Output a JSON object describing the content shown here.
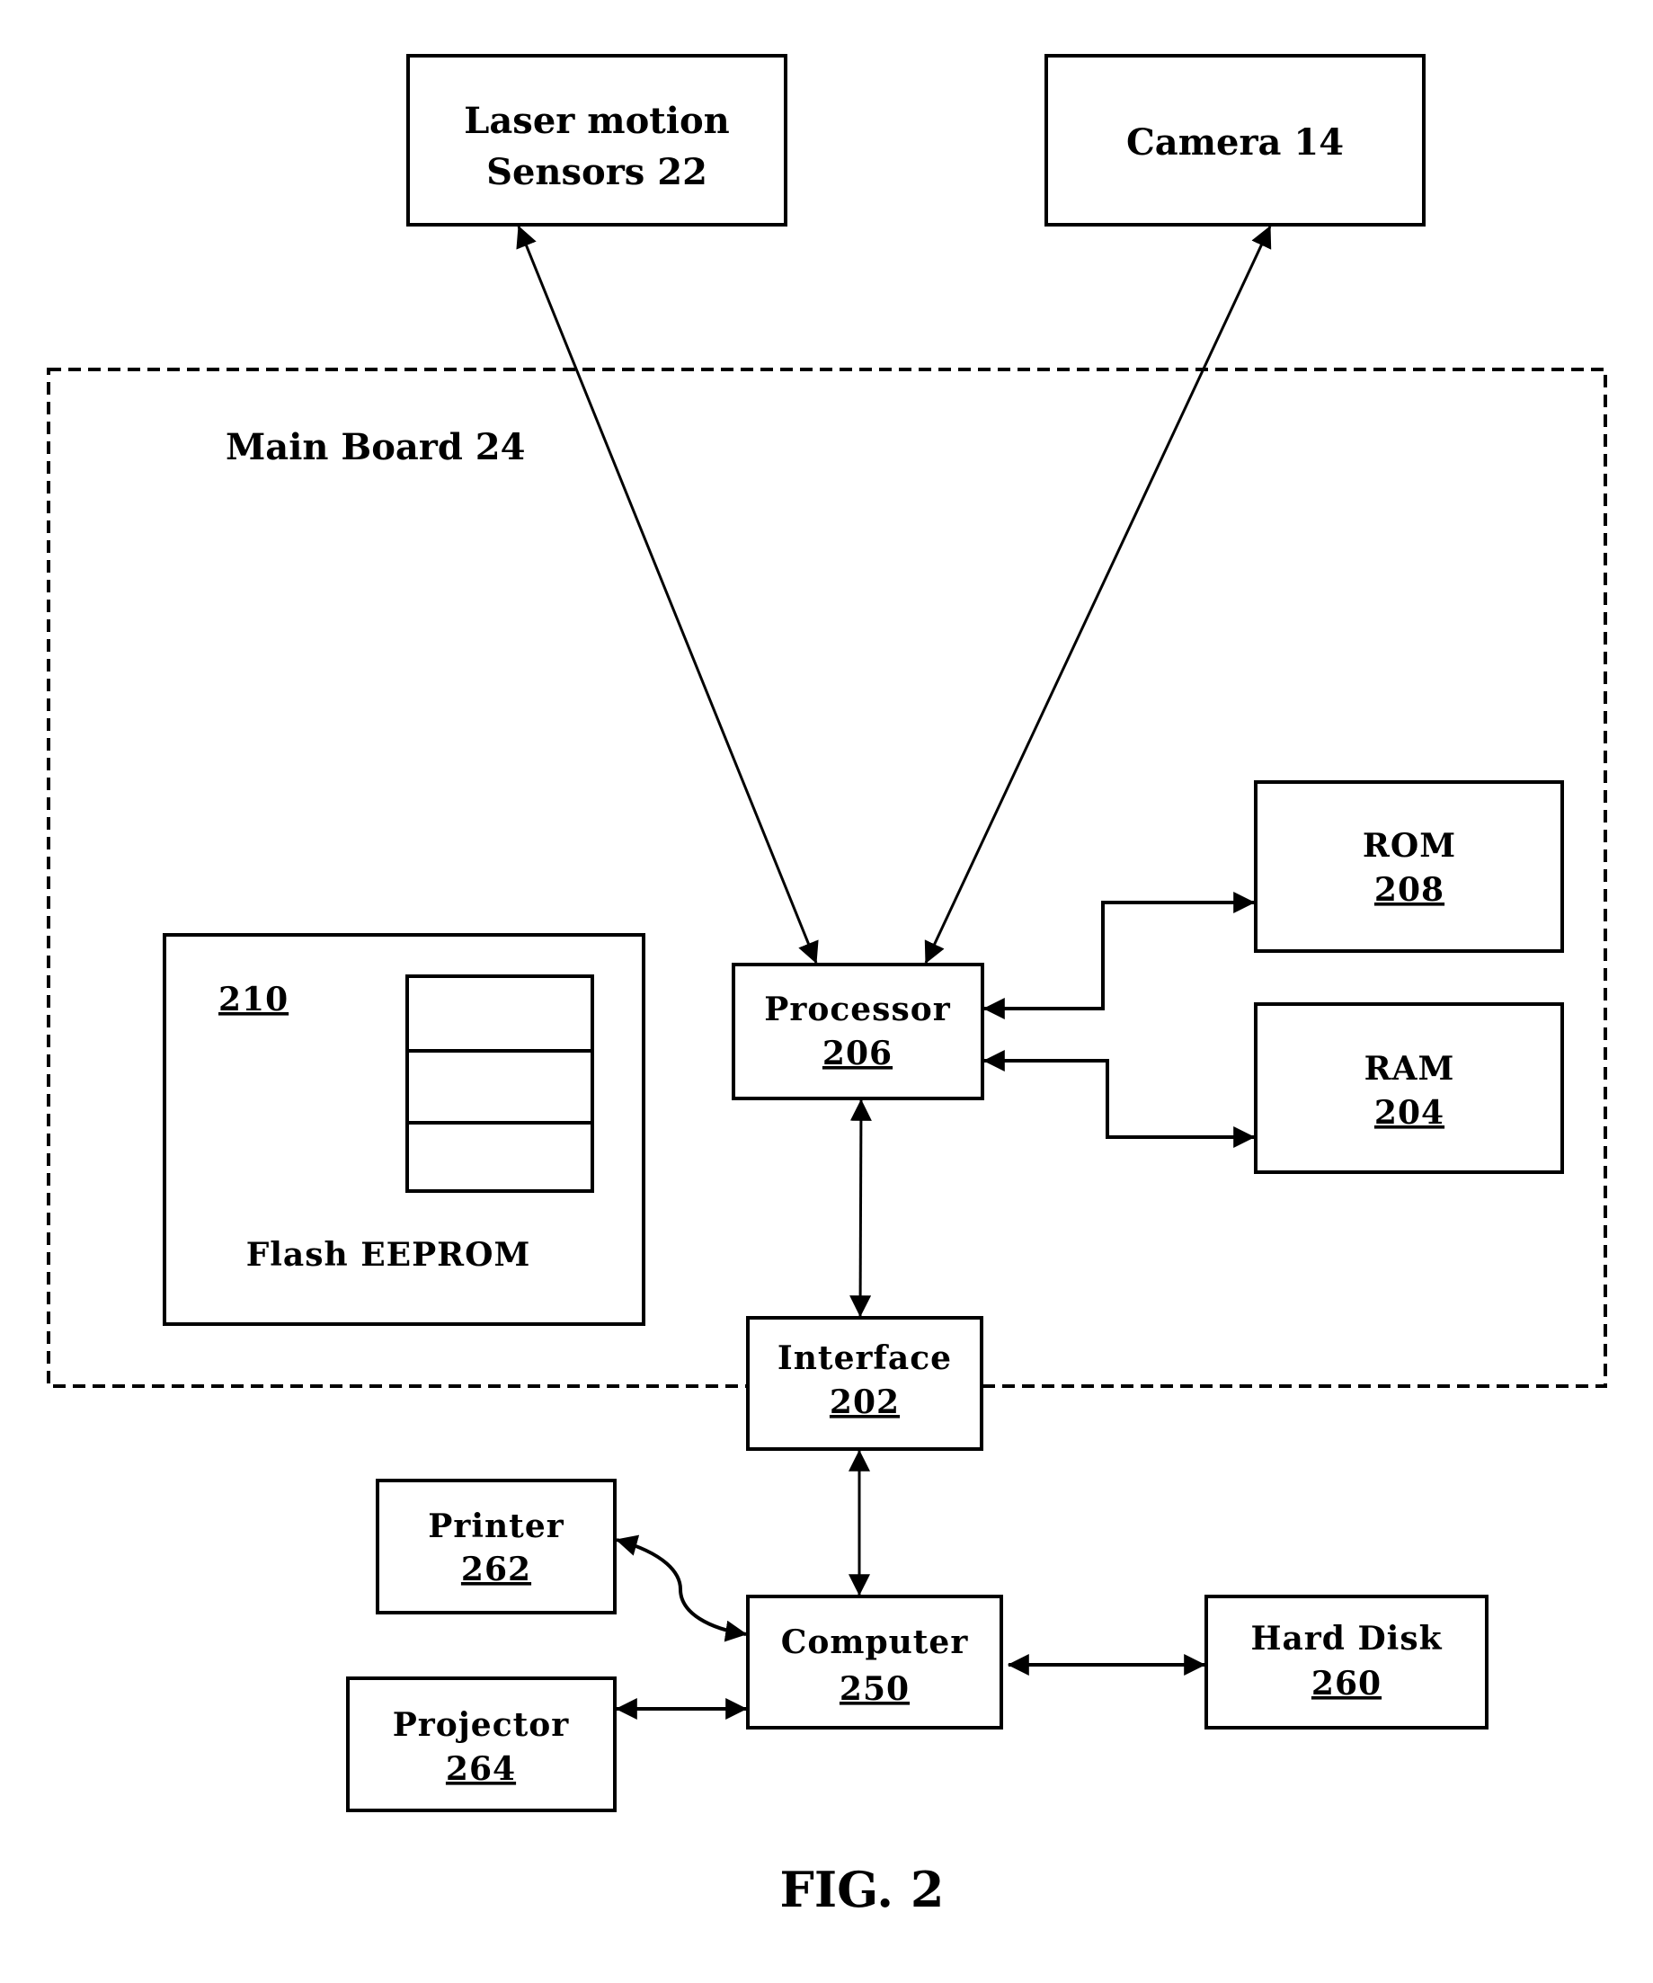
{
  "figure": {
    "caption": "FIG. 2",
    "container": {
      "label": "Main Board 24"
    },
    "blocks": {
      "laser": {
        "line1": "Laser motion",
        "line2": "Sensors 22"
      },
      "camera": {
        "name": "Camera 14"
      },
      "processor": {
        "name": "Processor",
        "ref": "206"
      },
      "rom": {
        "name": "ROM",
        "ref": "208"
      },
      "ram": {
        "name": "RAM",
        "ref": "204"
      },
      "flash": {
        "ref": "210",
        "name": "Flash EEPROM"
      },
      "interface": {
        "name": "Interface",
        "ref": "202"
      },
      "computer": {
        "name": "Computer",
        "ref": "250"
      },
      "printer": {
        "name": "Printer",
        "ref": "262"
      },
      "projector": {
        "name": "Projector",
        "ref": "264"
      },
      "harddisk": {
        "name": "Hard Disk",
        "ref": "260"
      }
    },
    "connections": [
      {
        "from": "Laser motion Sensors 22",
        "to": "Processor 206",
        "type": "bidirectional"
      },
      {
        "from": "Camera 14",
        "to": "Processor 206",
        "type": "bidirectional"
      },
      {
        "from": "Processor 206",
        "to": "ROM 208",
        "type": "bidirectional"
      },
      {
        "from": "Processor 206",
        "to": "RAM 204",
        "type": "bidirectional"
      },
      {
        "from": "Processor 206",
        "to": "Interface 202",
        "type": "bidirectional"
      },
      {
        "from": "Interface 202",
        "to": "Computer 250",
        "type": "bidirectional"
      },
      {
        "from": "Printer 262",
        "to": "Computer 250",
        "type": "bidirectional"
      },
      {
        "from": "Projector 264",
        "to": "Computer 250",
        "type": "bidirectional"
      },
      {
        "from": "Computer 250",
        "to": "Hard Disk 260",
        "type": "bidirectional"
      }
    ]
  }
}
